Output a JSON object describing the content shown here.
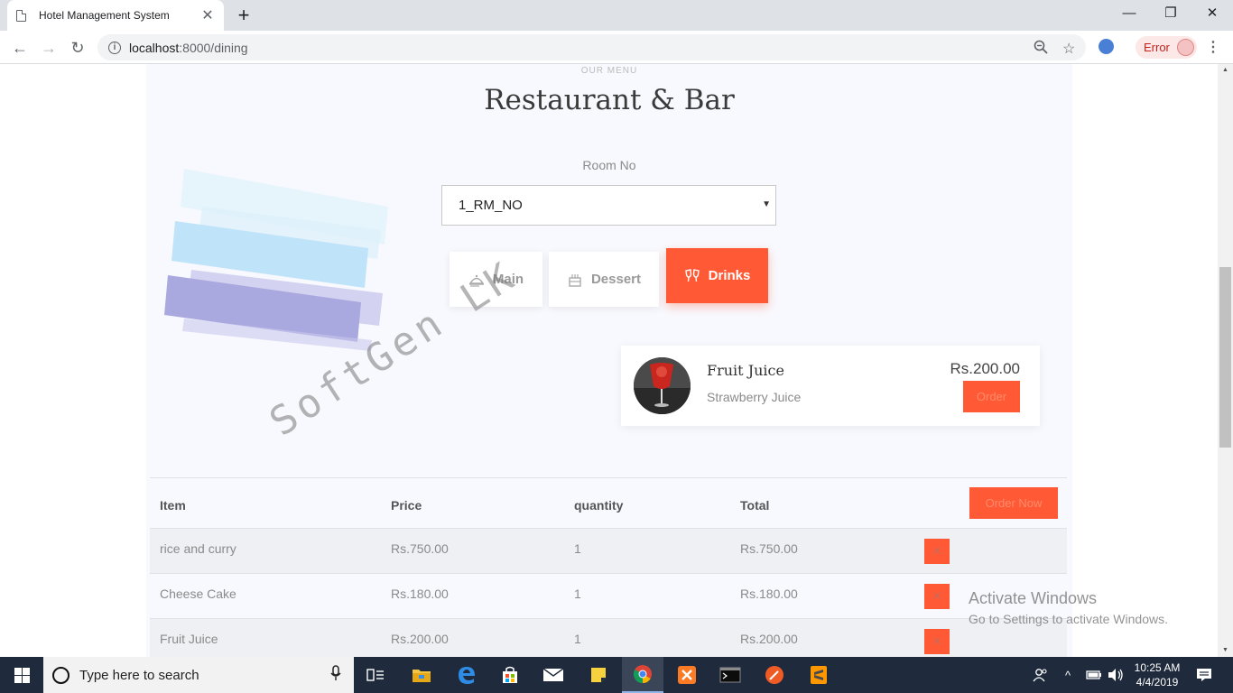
{
  "browser": {
    "tab_title": "Hotel Management System",
    "tab_close": "✕",
    "new_tab": "+",
    "url_host": "localhost",
    "url_path": ":8000/dining",
    "error_label": "Error",
    "window_controls": {
      "minimize": "—",
      "maximize": "❐",
      "close": "✕"
    }
  },
  "page": {
    "eyebrow": "OUR MENU",
    "title": "Restaurant & Bar",
    "room_label": "Room No",
    "room_selected": "1_RM_NO",
    "categories": [
      {
        "label": "Main",
        "icon": "serving-dish-icon",
        "active": false
      },
      {
        "label": "Dessert",
        "icon": "cake-icon",
        "active": false
      },
      {
        "label": "Drinks",
        "icon": "glasses-cheers-icon",
        "active": true
      }
    ],
    "menu_item": {
      "name": "Fruit Juice",
      "description": "Strawberry Juice",
      "price": "Rs.200.00",
      "order_label": "Order"
    },
    "watermark": "SoftGen LK",
    "table": {
      "headers": [
        "Item",
        "Price",
        "quantity",
        "Total"
      ],
      "order_now_label": "Order Now",
      "delete_label": "✕",
      "rows": [
        {
          "item": "rice and curry",
          "price": "Rs.750.00",
          "quantity": "1",
          "total": "Rs.750.00"
        },
        {
          "item": "Cheese Cake",
          "price": "Rs.180.00",
          "quantity": "1",
          "total": "Rs.180.00"
        },
        {
          "item": "Fruit Juice",
          "price": "Rs.200.00",
          "quantity": "1",
          "total": "Rs.200.00"
        }
      ]
    },
    "activate_windows": {
      "title": "Activate Windows",
      "subtitle": "Go to Settings to activate Windows."
    }
  },
  "taskbar": {
    "search_placeholder": "Type here to search",
    "time": "10:25 AM",
    "date": "4/4/2019"
  },
  "colors": {
    "accent": "#ff5a35",
    "panel_bg": "#f8f9fe",
    "taskbar_bg": "#1f2b3c"
  }
}
